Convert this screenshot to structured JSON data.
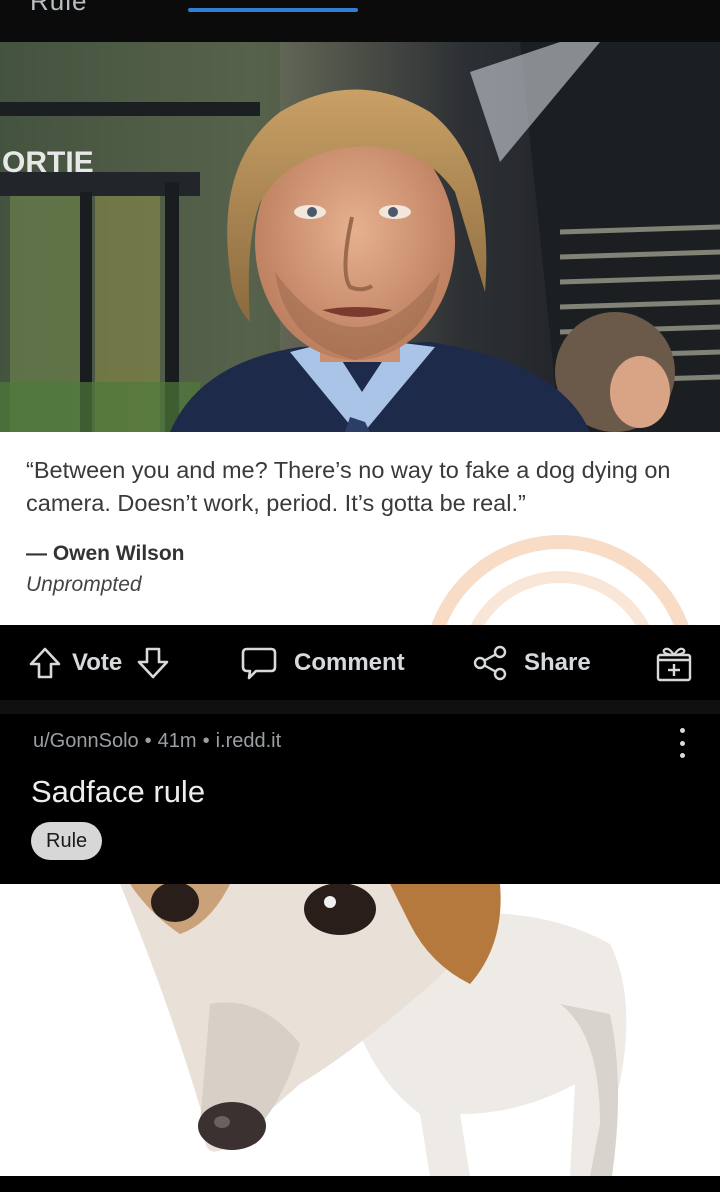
{
  "top": {
    "cut_title": "Rule",
    "accent": "#2f7fd6"
  },
  "meme": {
    "sign_text": "ORTIE",
    "quote": "“Between you and me? There’s no way to fake a dog dying on camera. Doesn’t work, period. It’s gotta be real.”",
    "author": "— Owen Wilson",
    "source": "Unprompted"
  },
  "actions": {
    "vote_label": "Vote",
    "comment_label": "Comment",
    "share_label": "Share",
    "icons": [
      "upvote-icon",
      "downvote-icon",
      "comment-icon",
      "share-icon",
      "award-icon"
    ]
  },
  "post": {
    "author": "u/GonnSolo",
    "age": "41m",
    "domain": "i.redd.it",
    "separator": "•",
    "title": "Sadface rule",
    "flair": "Rule"
  },
  "colors": {
    "background": "#000000",
    "text": "#d7dadc",
    "meta_text": "#9a9fa3",
    "flair_bg": "#d7d7d7"
  }
}
